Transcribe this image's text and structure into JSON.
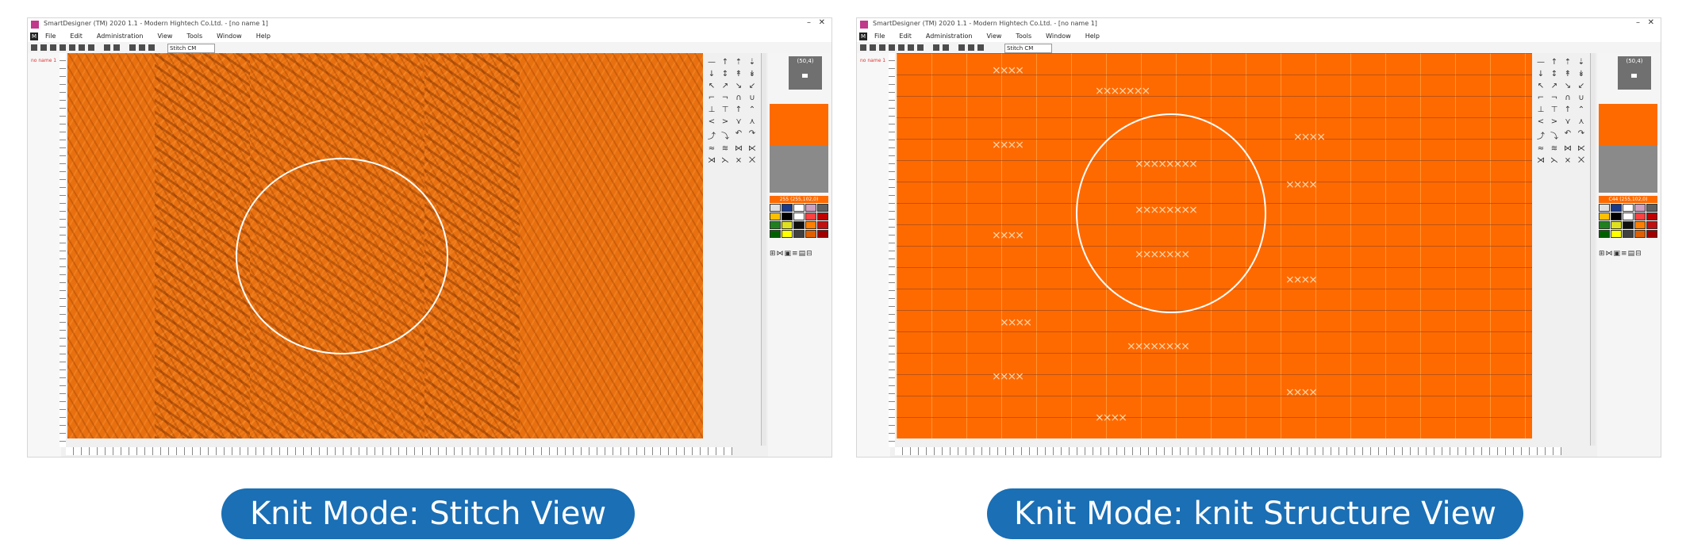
{
  "left_window": {
    "title": "SmartDesigner (TM) 2020 1.1 - Modern Hightech Co.Ltd. - [no name 1]",
    "menu": [
      "File",
      "Edit",
      "Administration",
      "View",
      "Tools",
      "Window",
      "Help"
    ],
    "zoom_value": "Stitch CM",
    "name_label": "no name 1",
    "preview_label": "(50,4)",
    "color_label": "255 (255,102,0)"
  },
  "right_window": {
    "title": "SmartDesigner (TM) 2020 1.1 - Modern Hightech Co.Ltd. - [no name 1]",
    "menu": [
      "File",
      "Edit",
      "Administration",
      "View",
      "Tools",
      "Window",
      "Help"
    ],
    "zoom_value": "Stitch CM",
    "name_label": "no name 1",
    "preview_label": "(50,4)",
    "color_label": "C44 (255,102,0)"
  },
  "tool_glyphs": [
    "—",
    "↑",
    "⇡",
    "⇣",
    "↓",
    "↕",
    "↟",
    "↡",
    "↖",
    "↗",
    "↘",
    "↙",
    "⌐",
    "¬",
    "∩",
    "∪",
    "⊥",
    "⊤",
    "↑",
    "⌃",
    "<",
    ">",
    "⋎",
    "⋏",
    "⤴",
    "⤵",
    "↶",
    "↷",
    "≈",
    "≋",
    "⋈",
    "⋉",
    "⋊",
    "⋋",
    "⨯",
    "⨉"
  ],
  "palette_colors": [
    "#e0e0e0",
    "#1c3a8a",
    "#ffffff",
    "#d0a0c0",
    "#606060",
    "#ffc000",
    "#000000",
    "#ffffff",
    "#ff4040",
    "#c00000",
    "#208020",
    "#e0e020",
    "#101010",
    "#ff8000",
    "#c01010",
    "#006000",
    "#ffff00",
    "#404040",
    "#e06000",
    "#a00000"
  ],
  "captions": {
    "left": "Knit Mode: Stitch View",
    "right": "Knit Mode: knit Structure View"
  }
}
